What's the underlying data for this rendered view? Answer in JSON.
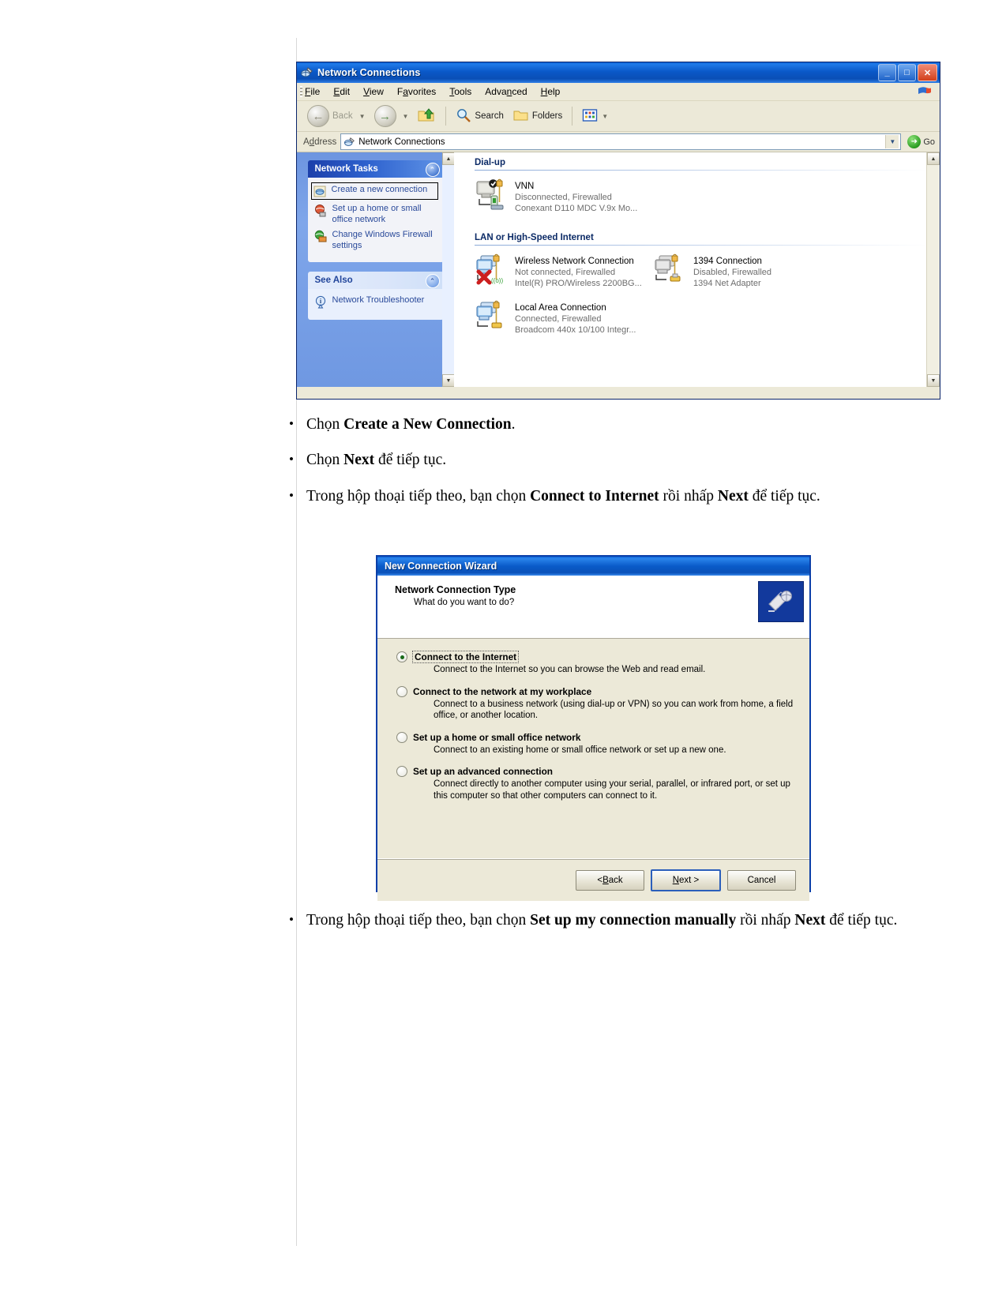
{
  "explorer": {
    "title": "Network Connections",
    "title_icon": "network-globe-icon",
    "window_buttons": {
      "minimize": "_",
      "maximize": "□",
      "close": "✕"
    },
    "menus": [
      "File",
      "Edit",
      "View",
      "Favorites",
      "Tools",
      "Advanced",
      "Help"
    ],
    "toolbar": {
      "back": "Back",
      "forward": "",
      "up": "",
      "search": "Search",
      "folders": "Folders",
      "views": ""
    },
    "address": {
      "label": "Address",
      "value": "Network Connections",
      "go": "Go"
    },
    "sidebar": {
      "panels": [
        {
          "title": "Network Tasks",
          "items": [
            {
              "label": "Create a new connection",
              "icon": "new-connection-icon",
              "focused": true
            },
            {
              "label": "Set up a home or small office network",
              "icon": "home-network-icon",
              "focused": false
            },
            {
              "label": "Change Windows Firewall settings",
              "icon": "firewall-icon",
              "focused": false
            }
          ]
        },
        {
          "title": "See Also",
          "items": [
            {
              "label": "Network Troubleshooter",
              "icon": "info-icon",
              "focused": false
            }
          ]
        }
      ]
    },
    "groups": [
      {
        "name": "Dial-up",
        "connections": [
          {
            "name": "VNN",
            "status": "Disconnected, Firewalled",
            "device": "Conexant D110 MDC V.9x Mo...",
            "icon": "dialup-connection-icon"
          }
        ]
      },
      {
        "name": "LAN or High-Speed Internet",
        "connections": [
          {
            "name": "Wireless Network Connection",
            "status": "Not connected, Firewalled",
            "device": "Intel(R) PRO/Wireless 2200BG...",
            "icon": "wireless-connection-icon"
          },
          {
            "name": "1394 Connection",
            "status": "Disabled, Firewalled",
            "device": "1394 Net Adapter",
            "icon": "firewire-connection-icon"
          },
          {
            "name": "Local Area Connection",
            "status": "Connected, Firewalled",
            "device": "Broadcom 440x 10/100 Integr...",
            "icon": "lan-connection-icon"
          }
        ]
      }
    ]
  },
  "body_text": {
    "bullets": [
      {
        "parts": [
          {
            "t": "Chọn ",
            "b": false
          },
          {
            "t": "Create a New Connection",
            "b": true
          },
          {
            "t": ".",
            "b": false
          }
        ]
      },
      {
        "parts": [
          {
            "t": "Chọn ",
            "b": false
          },
          {
            "t": "Next",
            "b": true
          },
          {
            "t": " để tiếp tục.",
            "b": false
          }
        ]
      },
      {
        "parts": [
          {
            "t": "Trong hộp thoại tiếp theo, bạn chọn ",
            "b": false
          },
          {
            "t": "Connect to Internet",
            "b": true
          },
          {
            "t": " rồi nhấp ",
            "b": false
          },
          {
            "t": "Next",
            "b": true
          },
          {
            "t": " để tiếp tục.",
            "b": false
          }
        ]
      }
    ],
    "bullets_after": [
      {
        "parts": [
          {
            "t": "Trong hộp thoại tiếp theo, bạn chọn ",
            "b": false
          },
          {
            "t": "Set up my connection manually",
            "b": true
          },
          {
            "t": " rồi nhấp ",
            "b": false
          },
          {
            "t": "Next",
            "b": true
          },
          {
            "t": " để tiếp tục.",
            "b": false
          }
        ]
      }
    ]
  },
  "wizard": {
    "title": "New Connection Wizard",
    "heading": "Network Connection Type",
    "subheading": "What do you want to do?",
    "badge_icon": "network-wizard-icon",
    "options": [
      {
        "label": "Connect to the Internet",
        "description": "Connect to the Internet so you can browse the Web and read email.",
        "selected": true,
        "focused": true
      },
      {
        "label": "Connect to the network at my workplace",
        "description": "Connect to a business network (using dial-up or VPN) so you can work from home, a field office, or another location.",
        "selected": false,
        "focused": false
      },
      {
        "label": "Set up a home or small office network",
        "description": "Connect to an existing home or small office network or set up a new one.",
        "selected": false,
        "focused": false
      },
      {
        "label": "Set up an advanced connection",
        "description": "Connect directly to another computer using your serial, parallel, or infrared port, or set up this computer so that other computers can connect to it.",
        "selected": false,
        "focused": false
      }
    ],
    "buttons": {
      "back": "< Back",
      "next": "Next >",
      "cancel": "Cancel"
    }
  },
  "colors": {
    "titlebar_blue": "#0a58c8",
    "sidebar_blue": "#7ba2e7",
    "dialog_face": "#ece9d8",
    "accent_green": "#2a9c20"
  }
}
